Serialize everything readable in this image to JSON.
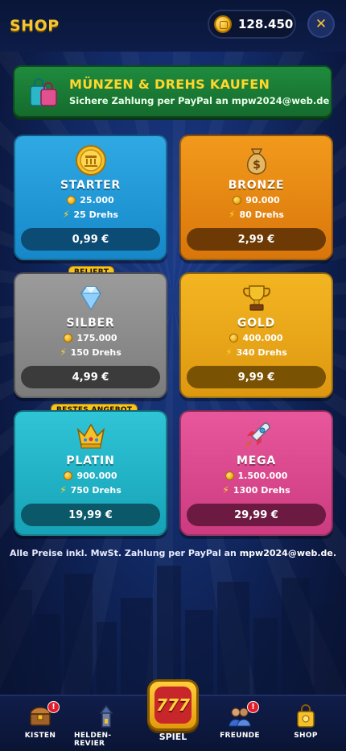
{
  "header": {
    "title": "SHOP",
    "coins": "128.450",
    "close_label": "✕"
  },
  "banner": {
    "title": "MÜNZEN & DREHS KAUFEN",
    "subtitle": "Sichere Zahlung per PayPal an mpw2024@web.de"
  },
  "packages": [
    {
      "name": "STARTER",
      "coins": "25.000",
      "spins": "25 Drehs",
      "price": "0,99 €",
      "icon": "coin-icon"
    },
    {
      "name": "BRONZE",
      "coins": "90.000",
      "spins": "80 Drehs",
      "price": "2,99 €",
      "icon": "money-bag-icon"
    },
    {
      "name": "SILBER",
      "coins": "175.000",
      "spins": "150 Drehs",
      "price": "4,99 €",
      "icon": "diamond-icon",
      "badge": "BELIEBT"
    },
    {
      "name": "GOLD",
      "coins": "400.000",
      "spins": "340 Drehs",
      "price": "9,99 €",
      "icon": "trophy-icon"
    },
    {
      "name": "PLATIN",
      "coins": "900.000",
      "spins": "750 Drehs",
      "price": "19,99 €",
      "icon": "crown-icon",
      "badge": "BESTES ANGEBOT"
    },
    {
      "name": "MEGA",
      "coins": "1.500.000",
      "spins": "1300 Drehs",
      "price": "29,99 €",
      "icon": "rocket-icon"
    }
  ],
  "footer": {
    "note_prefix": "Alle Preise inkl. MwSt. Zahlung per PayPal an ",
    "note_email": "mpw2024@web.de",
    "note_suffix": "."
  },
  "nav": {
    "kisten": "KISTEN",
    "helden": "HELDEN-REVIER",
    "spiel": "SPIEL",
    "freunde": "FREUNDE",
    "shop": "SHOP",
    "notif": "!"
  },
  "colors": {
    "accent_gold": "#f6c531",
    "banner_green": "#1f8b3e",
    "background": "#122a66"
  }
}
